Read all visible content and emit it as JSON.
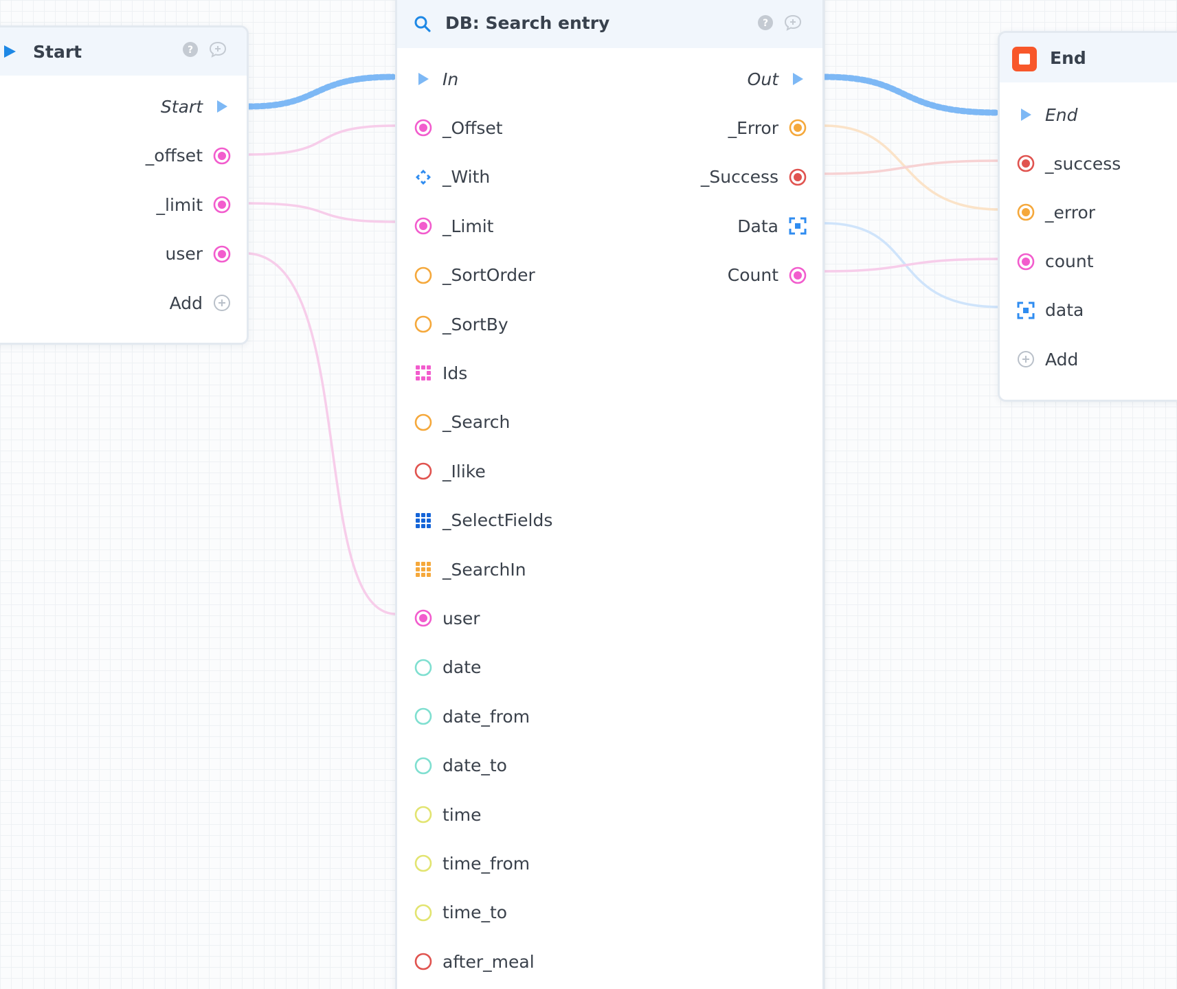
{
  "colors": {
    "pink": "#f25ccd",
    "orange": "#f5a83b",
    "red": "#e0534f",
    "blue": "#2f8cf0",
    "teal": "#7fdfd0",
    "yellow": "#e2e470",
    "exec": "#7db8f5",
    "end_badge": "#f8572a"
  },
  "start_node": {
    "title": "Start",
    "outputs": [
      {
        "label": "Start",
        "pin": "exec-arrow-icon"
      },
      {
        "label": "_offset",
        "pin": "pin-filled-pink"
      },
      {
        "label": "_limit",
        "pin": "pin-filled-pink"
      },
      {
        "label": "user",
        "pin": "pin-filled-pink"
      },
      {
        "label": "Add",
        "pin": "add-circle-icon"
      }
    ]
  },
  "search_node": {
    "title": "DB: Search entry",
    "inputs": [
      {
        "label": "In",
        "pin": "exec-arrow-icon"
      },
      {
        "label": "_Offset",
        "pin": "pin-filled-pink"
      },
      {
        "label": "_With",
        "pin": "diamond-blue-icon"
      },
      {
        "label": "_Limit",
        "pin": "pin-filled-pink"
      },
      {
        "label": "_SortOrder",
        "pin": "pin-empty-orange"
      },
      {
        "label": "_SortBy",
        "pin": "pin-empty-orange"
      },
      {
        "label": "Ids",
        "pin": "grid-pink-icon"
      },
      {
        "label": "_Search",
        "pin": "pin-empty-orange"
      },
      {
        "label": "_Ilike",
        "pin": "pin-empty-red"
      },
      {
        "label": "_SelectFields",
        "pin": "grid-blue-icon"
      },
      {
        "label": "_SearchIn",
        "pin": "grid-orange-icon"
      },
      {
        "label": "user",
        "pin": "pin-filled-pink"
      },
      {
        "label": "date",
        "pin": "pin-empty-teal"
      },
      {
        "label": "date_from",
        "pin": "pin-empty-teal"
      },
      {
        "label": "date_to",
        "pin": "pin-empty-teal"
      },
      {
        "label": "time",
        "pin": "pin-empty-yellow"
      },
      {
        "label": "time_from",
        "pin": "pin-empty-yellow"
      },
      {
        "label": "time_to",
        "pin": "pin-empty-yellow"
      },
      {
        "label": "after_meal",
        "pin": "pin-empty-red"
      }
    ],
    "outputs": [
      {
        "label": "Out",
        "pin": "exec-arrow-icon"
      },
      {
        "label": "_Error",
        "pin": "pin-filled-orange"
      },
      {
        "label": "_Success",
        "pin": "pin-filled-red"
      },
      {
        "label": "Data",
        "pin": "object-blue-icon"
      },
      {
        "label": "Count",
        "pin": "pin-filled-pink"
      }
    ]
  },
  "end_node": {
    "title": "End",
    "inputs": [
      {
        "label": "End",
        "pin": "exec-arrow-icon"
      },
      {
        "label": "_success",
        "pin": "pin-filled-red"
      },
      {
        "label": "_error",
        "pin": "pin-filled-orange"
      },
      {
        "label": "count",
        "pin": "pin-filled-pink"
      },
      {
        "label": "data",
        "pin": "object-blue-icon"
      },
      {
        "label": "Add",
        "pin": "add-circle-icon"
      }
    ]
  }
}
